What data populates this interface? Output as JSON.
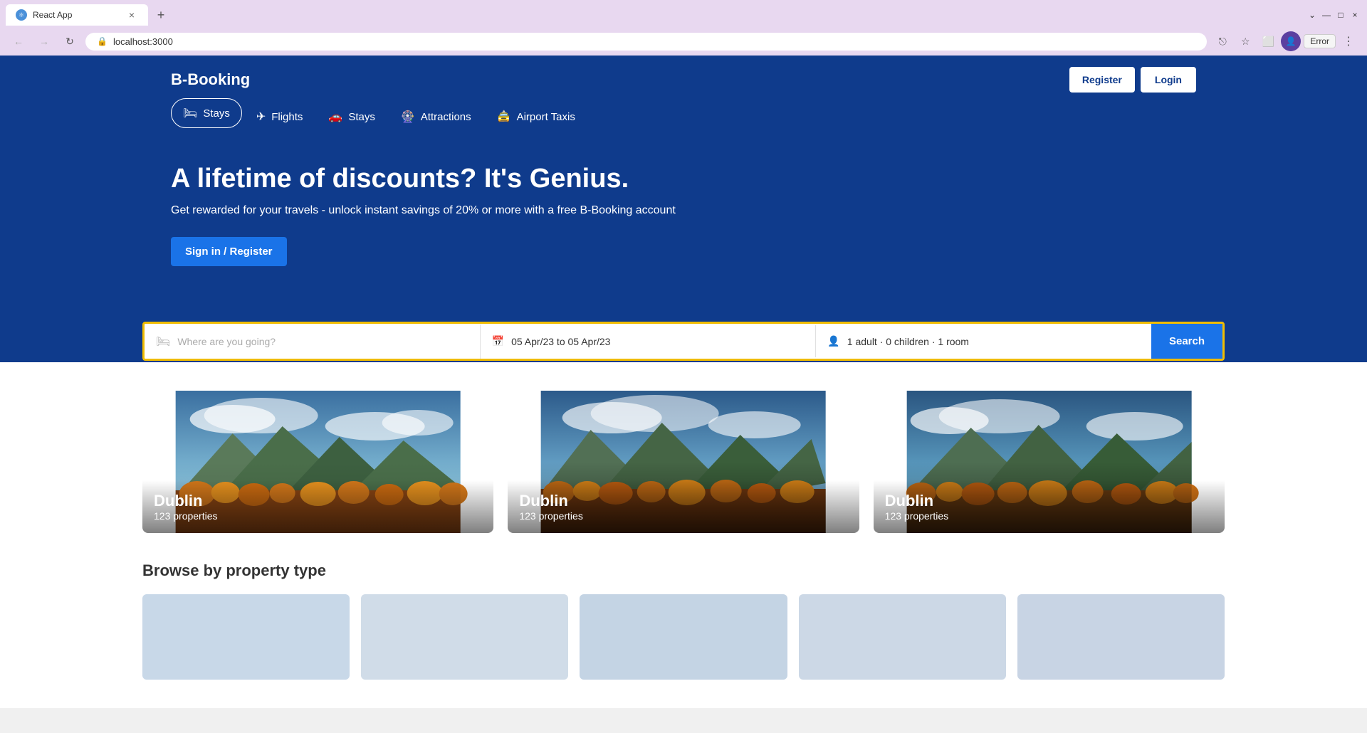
{
  "browser": {
    "tab_title": "React App",
    "tab_close": "×",
    "new_tab": "+",
    "nav_back": "←",
    "nav_forward": "→",
    "nav_refresh": "↻",
    "url": "localhost:3000",
    "window_minimize": "—",
    "window_maximize": "□",
    "window_close": "×",
    "error_label": "Error",
    "more_label": "⋮",
    "down_arrow": "⌄"
  },
  "header": {
    "brand": "B-Booking",
    "register_label": "Register",
    "login_label": "Login"
  },
  "nav": {
    "items": [
      {
        "id": "stays",
        "label": "Stays",
        "icon": "🛏",
        "active": true
      },
      {
        "id": "flights",
        "label": "Flights",
        "icon": "✈",
        "active": false
      },
      {
        "id": "stays2",
        "label": "Stays",
        "icon": "🚗",
        "active": false
      },
      {
        "id": "attractions",
        "label": "Attractions",
        "icon": "🛏",
        "active": false
      },
      {
        "id": "airport-taxis",
        "label": "Airport Taxis",
        "icon": "🚖",
        "active": false
      }
    ]
  },
  "hero": {
    "title": "A lifetime of discounts? It's Genius.",
    "subtitle": "Get rewarded for your travels - unlock instant savings of 20% or more with a free B-Booking account",
    "cta_label": "Sign in / Register"
  },
  "search": {
    "destination_placeholder": "Where are you going?",
    "dates_value": "05 Apr/23 to 05 Apr/23",
    "guests_value": "1 adult · 0 children · 1 room",
    "search_label": "Search"
  },
  "featured_cities": [
    {
      "city": "Dublin",
      "count": "123 properties"
    },
    {
      "city": "Dublin",
      "count": "123 properties"
    },
    {
      "city": "Dublin",
      "count": "123 properties"
    }
  ],
  "browse_section": {
    "title": "Browse by property type"
  }
}
